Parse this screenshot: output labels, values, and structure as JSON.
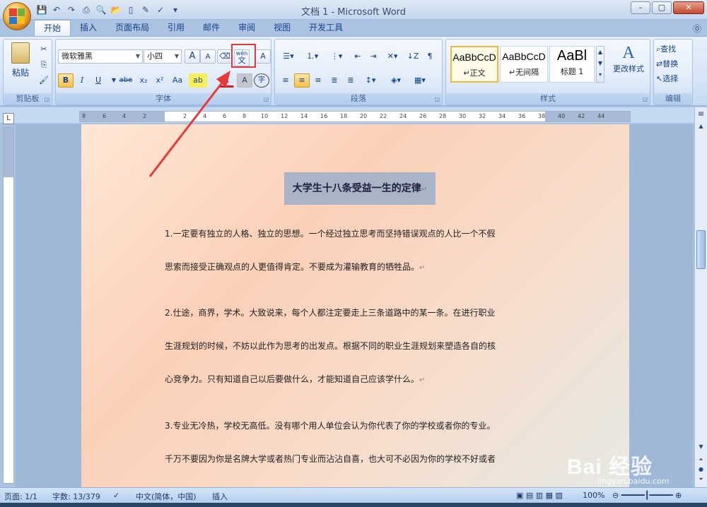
{
  "window": {
    "title": "文档 1 - Microsoft Word",
    "controls": [
      "–",
      "▢",
      "✕"
    ]
  },
  "tabs": [
    "开始",
    "插入",
    "页面布局",
    "引用",
    "邮件",
    "审阅",
    "视图",
    "开发工具"
  ],
  "ribbon": {
    "clipboard": {
      "label": "剪贴板",
      "paste": "粘贴"
    },
    "font": {
      "label": "字体",
      "font_name": "微软雅黑",
      "font_size": "小四",
      "grow": "A",
      "shrink": "A",
      "bold": "B",
      "italic": "I",
      "underline": "U",
      "strike": "abe",
      "subscript": "x₂",
      "superscript": "x²",
      "change_case": "Aa",
      "char_shading": "A",
      "enclose": "字",
      "phonetic": "wén",
      "border": "A",
      "phonetic_char": "文"
    },
    "paragraph": {
      "label": "段落"
    },
    "styles": {
      "label": "样式",
      "items": [
        {
          "sample": "AaBbCcD",
          "name": "↵正文"
        },
        {
          "sample": "AaBbCcD",
          "name": "↵无间隔"
        },
        {
          "sample": "AaBl",
          "name": "标题 1"
        }
      ],
      "change_styles": "更改样式"
    },
    "editing": {
      "label": "编辑",
      "find": "查找",
      "replace": "替换",
      "select": "选择"
    }
  },
  "ruler": {
    "ticks": [
      "8",
      "6",
      "4",
      "2",
      "2",
      "4",
      "6",
      "8",
      "10",
      "12",
      "14",
      "16",
      "18",
      "20",
      "22",
      "24",
      "26",
      "28",
      "30",
      "32",
      "34",
      "36",
      "38",
      "40",
      "42",
      "44"
    ]
  },
  "document": {
    "title": "大学生十八条受益一生的定律",
    "paragraphs": [
      [
        "1.一定要有独立的人格、独立的思想。一个经过独立思考而坚持错误观点的人比一个不假",
        "思索而接受正确观点的人更值得肯定。不要成为灌输教育的牺牲品。"
      ],
      [
        "2.仕途，商界，学术。大致说来，每个人都注定要走上三条道路中的某一条。在进行职业",
        "生涯规划的时候，不妨以此作为思考的出发点。根据不同的职业生涯规划来塑造各自的核",
        "心竞争力。只有知道自己以后要做什么，才能知道自己应该学什么。"
      ],
      [
        "3.专业无冷热，学校无高低。没有哪个用人单位会认为你代表了你的学校或者你的专业。",
        "千万不要因为你是名牌大学或者热门专业而沾沾自喜，也大可不必因为你的学校不好或者"
      ]
    ]
  },
  "status": {
    "page": "页面: 1/1",
    "words": "字数: 13/379",
    "language": "中文(简体，中国)",
    "mode": "插入",
    "zoom": "100%"
  },
  "watermark": {
    "text": "Bai 经验",
    "sub": "jingyan.baidu.com"
  }
}
